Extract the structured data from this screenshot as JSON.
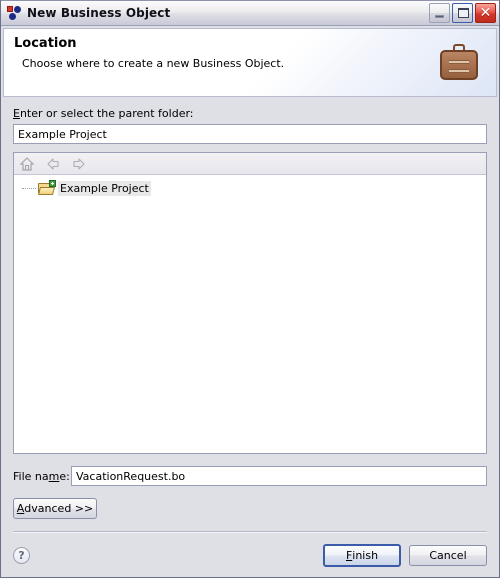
{
  "window": {
    "title": "New Business Object",
    "icon": "business-object-icon",
    "controls": {
      "minimize": "minimize-icon",
      "maximize": "maximize-icon",
      "close": "close-icon"
    }
  },
  "banner": {
    "title": "Location",
    "description": "Choose where to create a new Business Object.",
    "icon": "briefcase-icon"
  },
  "content": {
    "parent_folder_label_pre": "E",
    "parent_folder_label_post": "nter or select the parent folder:",
    "parent_folder_value": "Example Project",
    "parent_folder_placeholder": "",
    "toolbar": {
      "home": "home-icon",
      "back": "back-arrow-icon",
      "forward": "forward-arrow-icon"
    },
    "tree": {
      "items": [
        {
          "label": "Example Project",
          "icon": "open-folder-icon",
          "selected": true
        }
      ]
    },
    "filename_label_pre": "File na",
    "filename_label_mn": "m",
    "filename_label_post": "e:",
    "filename_value": "VacationRequest.bo",
    "filename_placeholder": "",
    "advanced_label_mn": "A",
    "advanced_label_post": "dvanced >>"
  },
  "footer": {
    "help": "?",
    "finish_mn": "F",
    "finish_post": "inish",
    "cancel_label": "Cancel"
  },
  "colors": {
    "accent": "#3b5ca8",
    "close": "#d8372a",
    "dialog_bg": "#dfdfe6",
    "banner_bg": "#ffffff",
    "briefcase": "#a8714f"
  }
}
